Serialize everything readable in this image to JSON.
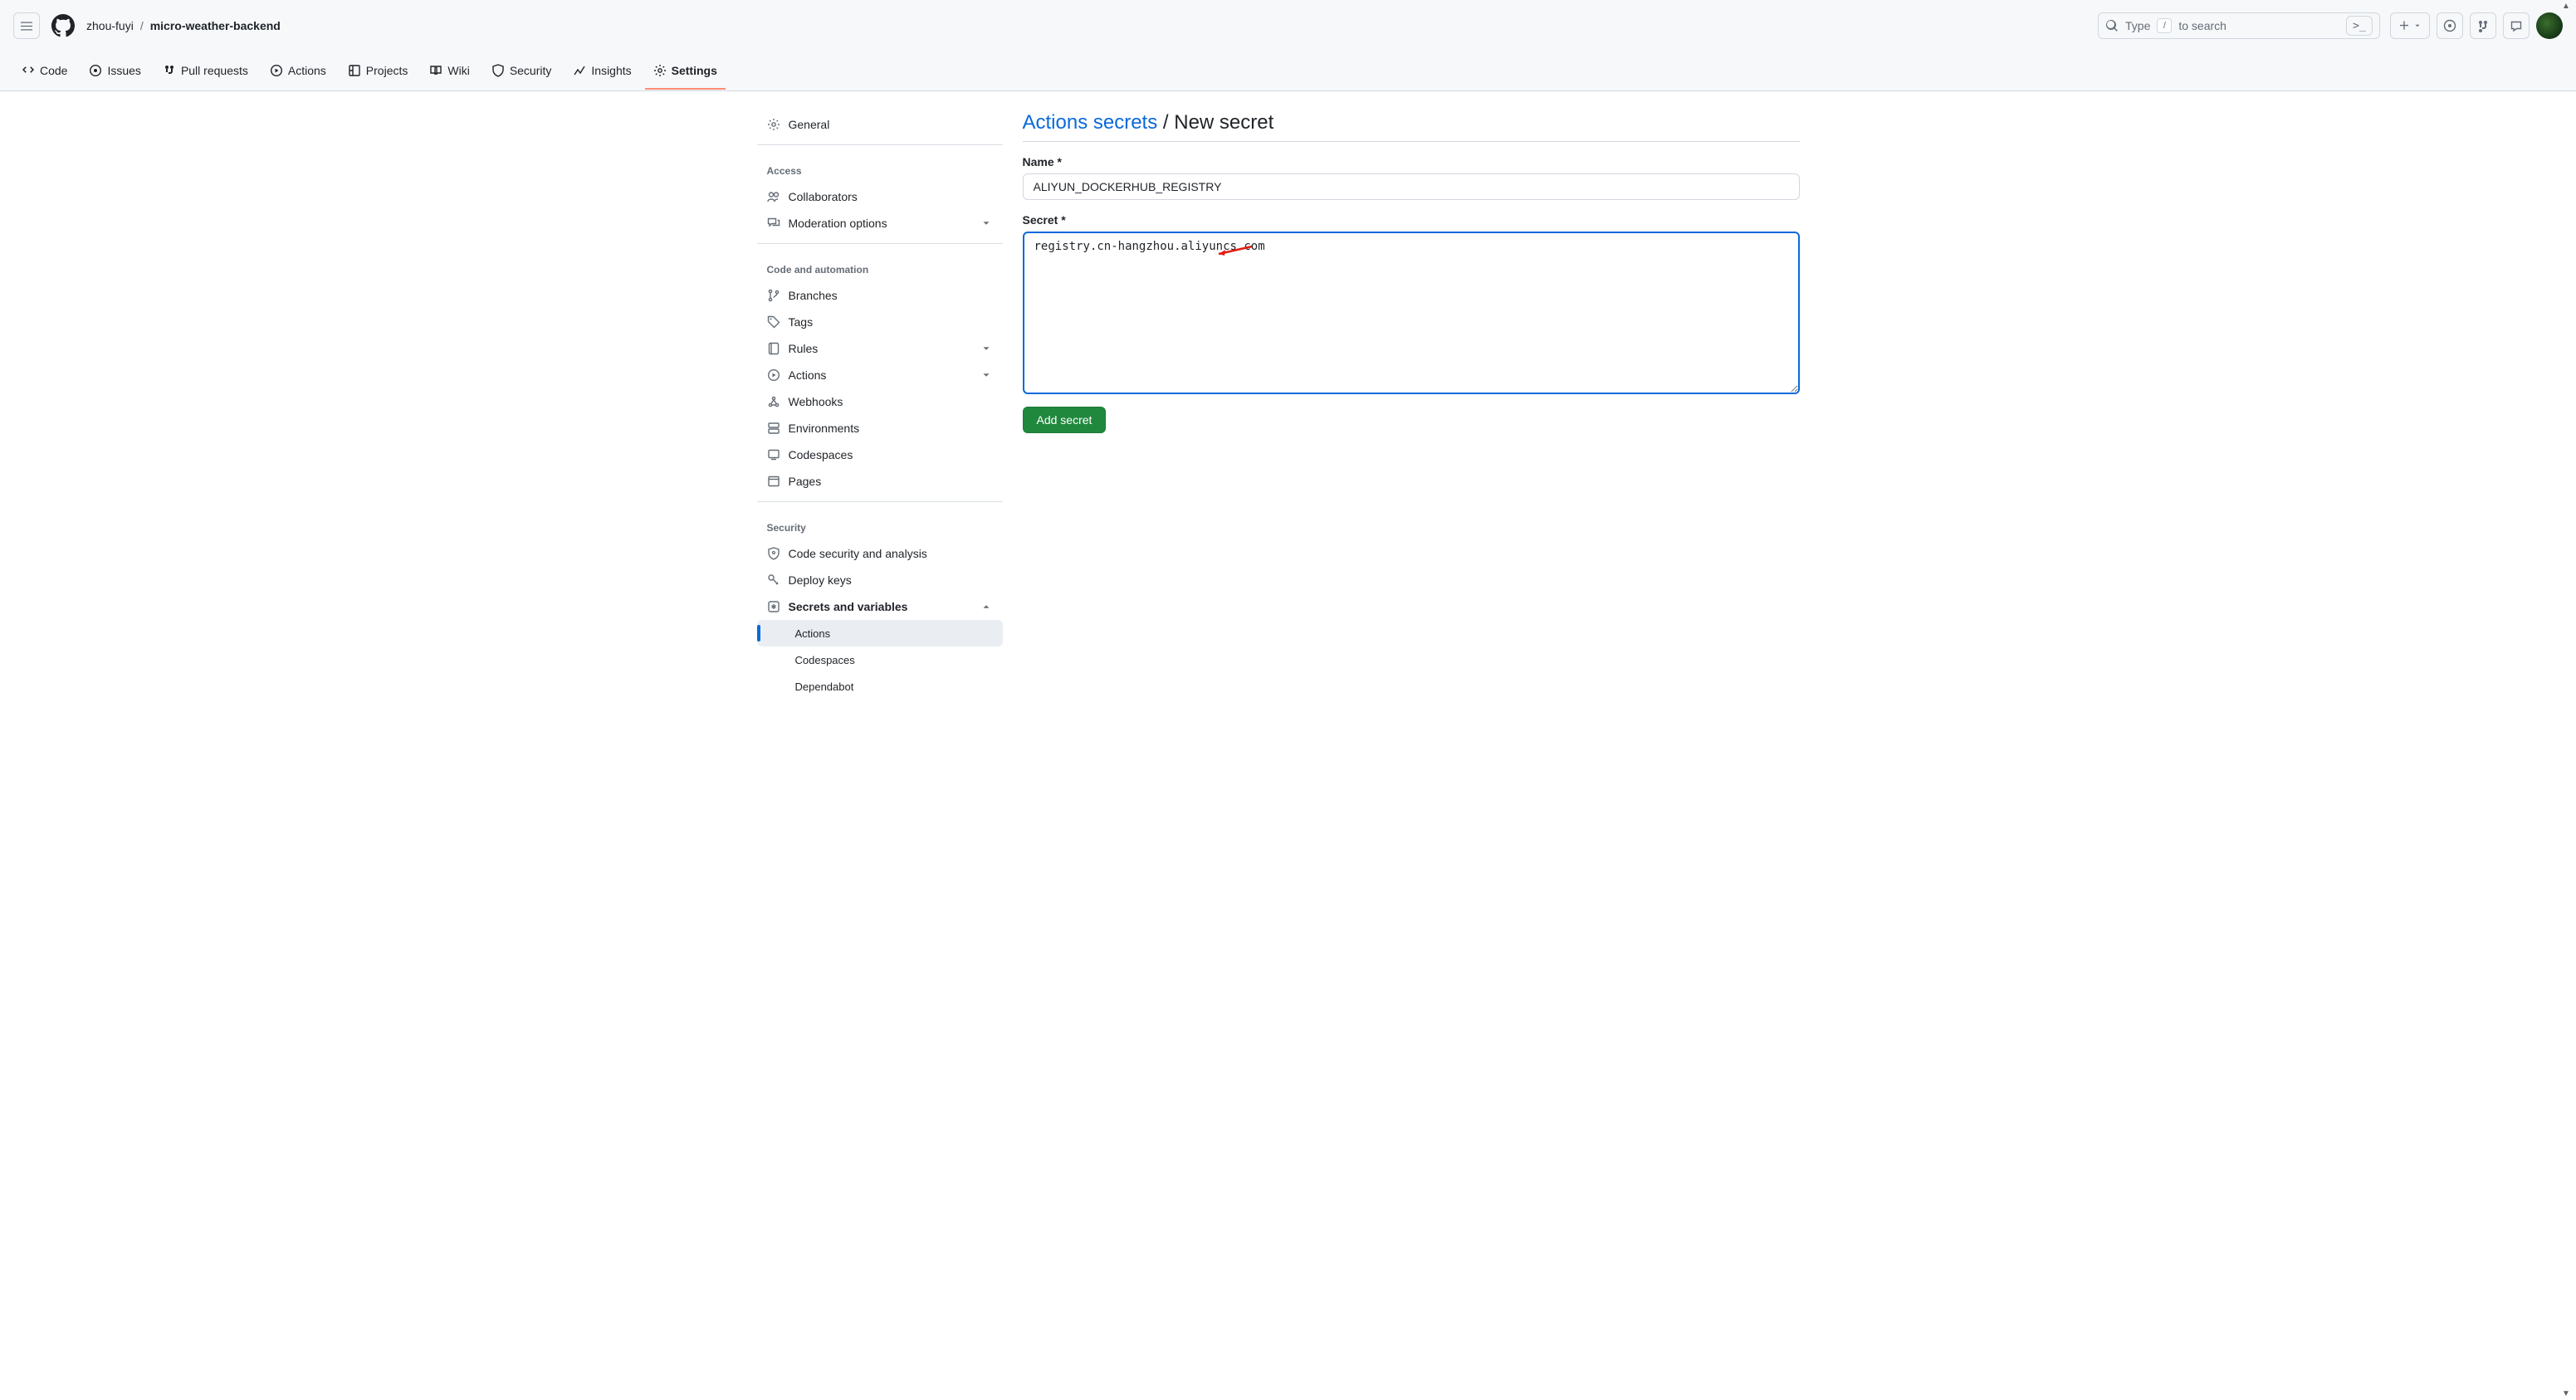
{
  "header": {
    "owner": "zhou-fuyi",
    "repo": "micro-weather-backend",
    "search": {
      "placeholder_prefix": "Type",
      "kbd": "/",
      "placeholder_suffix": "to search",
      "trail": ">_"
    }
  },
  "repo_tabs": [
    "Code",
    "Issues",
    "Pull requests",
    "Actions",
    "Projects",
    "Wiki",
    "Security",
    "Insights",
    "Settings"
  ],
  "repo_tabs_active_index": 8,
  "sidebar": {
    "general": "General",
    "groups": [
      {
        "title": "Access",
        "items": [
          {
            "label": "Collaborators",
            "icon": "people-icon"
          },
          {
            "label": "Moderation options",
            "icon": "comment-discussion-icon",
            "chev": true
          }
        ]
      },
      {
        "title": "Code and automation",
        "items": [
          {
            "label": "Branches",
            "icon": "git-branch-icon"
          },
          {
            "label": "Tags",
            "icon": "tag-icon"
          },
          {
            "label": "Rules",
            "icon": "repo-icon",
            "chev": true
          },
          {
            "label": "Actions",
            "icon": "play-icon",
            "chev": true
          },
          {
            "label": "Webhooks",
            "icon": "webhook-icon"
          },
          {
            "label": "Environments",
            "icon": "server-icon"
          },
          {
            "label": "Codespaces",
            "icon": "codespaces-icon"
          },
          {
            "label": "Pages",
            "icon": "browser-icon"
          }
        ]
      },
      {
        "title": "Security",
        "items": [
          {
            "label": "Code security and analysis",
            "icon": "shield-icon"
          },
          {
            "label": "Deploy keys",
            "icon": "key-icon"
          },
          {
            "label": "Secrets and variables",
            "icon": "key-asterisk-icon",
            "chev": true,
            "bold": true,
            "expanded": true,
            "sub": [
              {
                "label": "Actions",
                "active": true
              },
              {
                "label": "Codespaces"
              },
              {
                "label": "Dependabot"
              }
            ]
          }
        ]
      }
    ]
  },
  "page": {
    "breadcrumb_root": "Actions secrets",
    "breadcrumb_leaf": "New secret",
    "name_label": "Name *",
    "name_value": "ALIYUN_DOCKERHUB_REGISTRY",
    "secret_label": "Secret *",
    "secret_value": "registry.cn-hangzhou.aliyuncs.com",
    "submit_label": "Add secret"
  },
  "annotation": {
    "arrow_color": "#e11d12"
  }
}
